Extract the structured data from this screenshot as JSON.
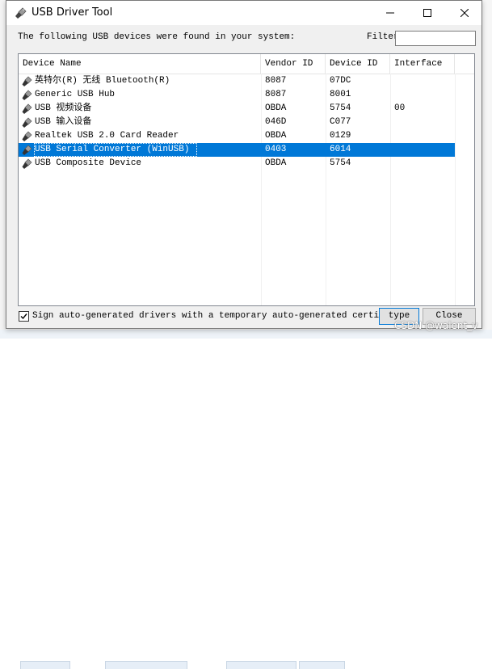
{
  "window": {
    "title": "USB Driver Tool",
    "prompt": "The following USB devices were found in your system:",
    "filter_label": "Filter",
    "filter_value": ""
  },
  "columns": [
    "Device Name",
    "Vendor ID",
    "Device ID",
    "Interface"
  ],
  "devices": [
    {
      "name": "英特尔(R) 无线 Bluetooth(R)",
      "vendor": "8087",
      "device": "07DC",
      "interface": "",
      "selected": false
    },
    {
      "name": "Generic USB Hub",
      "vendor": "8087",
      "device": "8001",
      "interface": "",
      "selected": false
    },
    {
      "name": "USB 视频设备",
      "vendor": "OBDA",
      "device": "5754",
      "interface": "00",
      "selected": false
    },
    {
      "name": "USB 输入设备",
      "vendor": "046D",
      "device": "C077",
      "interface": "",
      "selected": false
    },
    {
      "name": "Realtek USB 2.0 Card Reader",
      "vendor": "OBDA",
      "device": "0129",
      "interface": "",
      "selected": false
    },
    {
      "name": "USB Serial Converter (WinUSB)",
      "vendor": "0403",
      "device": "6014",
      "interface": "",
      "selected": true
    },
    {
      "name": "USB Composite Device",
      "vendor": "OBDA",
      "device": "5754",
      "interface": "",
      "selected": false
    }
  ],
  "footer": {
    "sign_checked": true,
    "sign_label": "Sign auto-generated drivers with a temporary auto-generated certificate",
    "type_button": "type",
    "close_button": "Close"
  },
  "watermark": "CSDN @walent_v",
  "colors": {
    "selection": "#0078d7",
    "accent": "#0078d7"
  },
  "icons": {
    "app": "usb-plug-icon",
    "row": "usb-plug-icon"
  }
}
